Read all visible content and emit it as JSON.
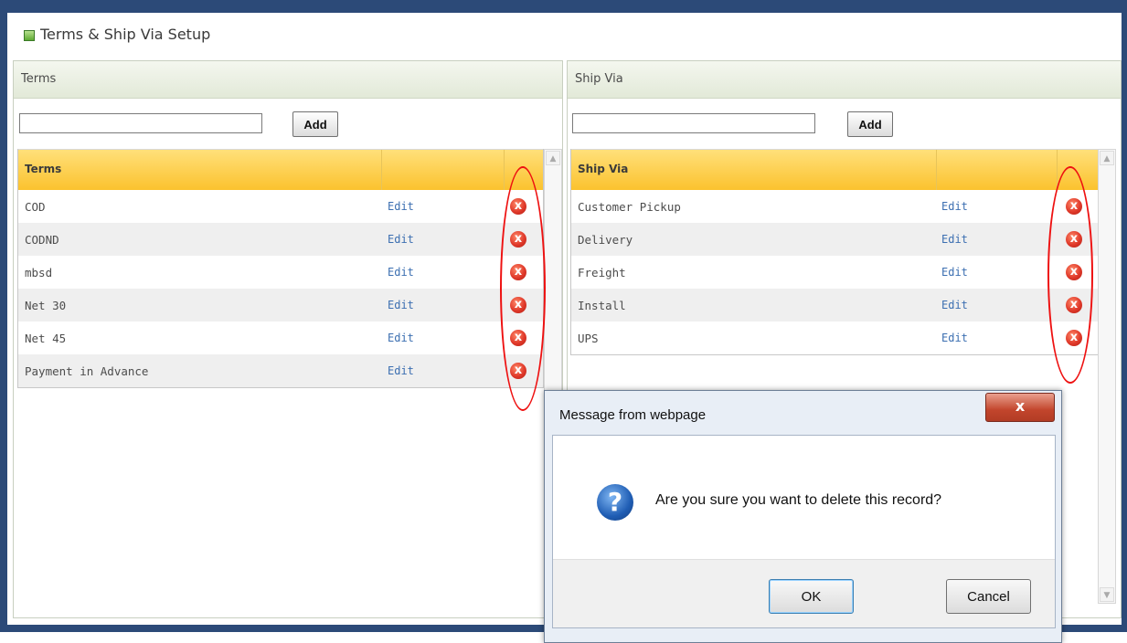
{
  "page": {
    "title": "Terms & Ship Via Setup"
  },
  "terms": {
    "panel_title": "Terms",
    "add_input_value": "",
    "add_label": "Add",
    "column_header": "Terms",
    "edit_label": "Edit",
    "delete_icon": "x",
    "rows": [
      {
        "name": "COD"
      },
      {
        "name": "CODND"
      },
      {
        "name": "mbsd"
      },
      {
        "name": "Net 30"
      },
      {
        "name": "Net 45"
      },
      {
        "name": "Payment in Advance"
      }
    ]
  },
  "ship_via": {
    "panel_title": "Ship Via",
    "add_input_value": "",
    "add_label": "Add",
    "column_header": "Ship Via",
    "edit_label": "Edit",
    "delete_icon": "x",
    "rows": [
      {
        "name": "Customer Pickup"
      },
      {
        "name": "Delivery"
      },
      {
        "name": "Freight"
      },
      {
        "name": "Install"
      },
      {
        "name": "UPS"
      }
    ]
  },
  "dialog": {
    "title": "Message from webpage",
    "message": "Are you sure you want to delete this record?",
    "ok_label": "OK",
    "cancel_label": "Cancel",
    "close_label": "x",
    "question_icon": "?"
  },
  "colors": {
    "frame": "#2c4a78",
    "grid_header": "#fbc22e",
    "link": "#3c6fb1",
    "highlight_oval": "#ee1111"
  }
}
